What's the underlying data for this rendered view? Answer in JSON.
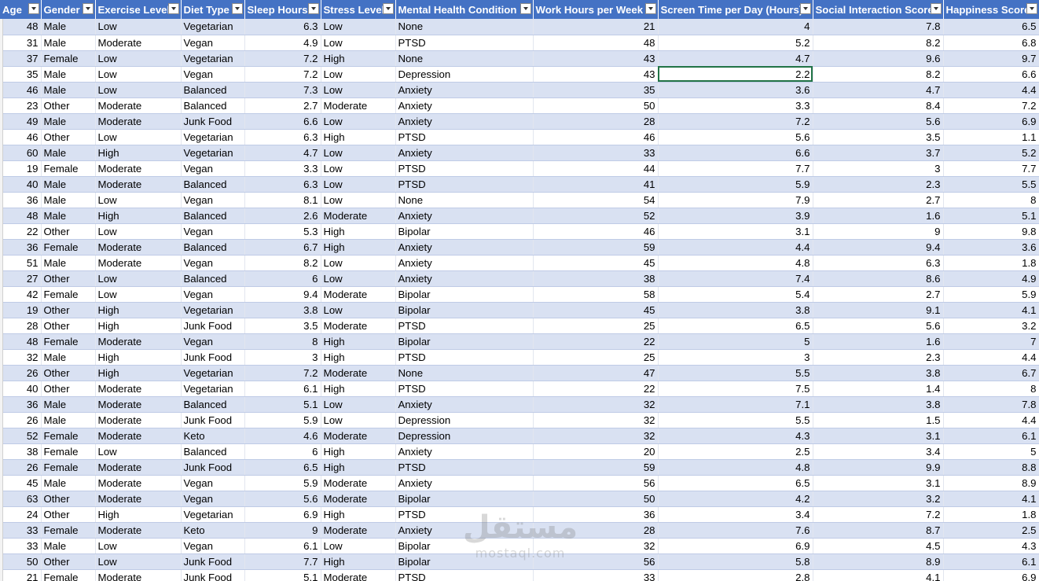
{
  "columns": [
    "Age",
    "Gender",
    "Exercise Level",
    "Diet Type",
    "Sleep Hours",
    "Stress Level",
    "Mental Health Condition",
    "Work Hours per Week",
    "Screen Time per Day (Hours)",
    "Social Interaction Score",
    "Happiness Score"
  ],
  "rows": [
    [
      "48",
      "Male",
      "Low",
      "Vegetarian",
      "6.3",
      "Low",
      "None",
      "21",
      "4",
      "7.8",
      "6.5"
    ],
    [
      "31",
      "Male",
      "Moderate",
      "Vegan",
      "4.9",
      "Low",
      "PTSD",
      "48",
      "5.2",
      "8.2",
      "6.8"
    ],
    [
      "37",
      "Female",
      "Low",
      "Vegetarian",
      "7.2",
      "High",
      "None",
      "43",
      "4.7",
      "9.6",
      "9.7"
    ],
    [
      "35",
      "Male",
      "Low",
      "Vegan",
      "7.2",
      "Low",
      "Depression",
      "43",
      "2.2",
      "8.2",
      "6.6"
    ],
    [
      "46",
      "Male",
      "Low",
      "Balanced",
      "7.3",
      "Low",
      "Anxiety",
      "35",
      "3.6",
      "4.7",
      "4.4"
    ],
    [
      "23",
      "Other",
      "Moderate",
      "Balanced",
      "2.7",
      "Moderate",
      "Anxiety",
      "50",
      "3.3",
      "8.4",
      "7.2"
    ],
    [
      "49",
      "Male",
      "Moderate",
      "Junk Food",
      "6.6",
      "Low",
      "Anxiety",
      "28",
      "7.2",
      "5.6",
      "6.9"
    ],
    [
      "46",
      "Other",
      "Low",
      "Vegetarian",
      "6.3",
      "High",
      "PTSD",
      "46",
      "5.6",
      "3.5",
      "1.1"
    ],
    [
      "60",
      "Male",
      "High",
      "Vegetarian",
      "4.7",
      "Low",
      "Anxiety",
      "33",
      "6.6",
      "3.7",
      "5.2"
    ],
    [
      "19",
      "Female",
      "Moderate",
      "Vegan",
      "3.3",
      "Low",
      "PTSD",
      "44",
      "7.7",
      "3",
      "7.7"
    ],
    [
      "40",
      "Male",
      "Moderate",
      "Balanced",
      "6.3",
      "Low",
      "PTSD",
      "41",
      "5.9",
      "2.3",
      "5.5"
    ],
    [
      "36",
      "Male",
      "Low",
      "Vegan",
      "8.1",
      "Low",
      "None",
      "54",
      "7.9",
      "2.7",
      "8"
    ],
    [
      "48",
      "Male",
      "High",
      "Balanced",
      "2.6",
      "Moderate",
      "Anxiety",
      "52",
      "3.9",
      "1.6",
      "5.1"
    ],
    [
      "22",
      "Other",
      "Low",
      "Vegan",
      "5.3",
      "High",
      "Bipolar",
      "46",
      "3.1",
      "9",
      "9.8"
    ],
    [
      "36",
      "Female",
      "Moderate",
      "Balanced",
      "6.7",
      "High",
      "Anxiety",
      "59",
      "4.4",
      "9.4",
      "3.6"
    ],
    [
      "51",
      "Male",
      "Moderate",
      "Vegan",
      "8.2",
      "Low",
      "Anxiety",
      "45",
      "4.8",
      "6.3",
      "1.8"
    ],
    [
      "27",
      "Other",
      "Low",
      "Balanced",
      "6",
      "Low",
      "Anxiety",
      "38",
      "7.4",
      "8.6",
      "4.9"
    ],
    [
      "42",
      "Female",
      "Low",
      "Vegan",
      "9.4",
      "Moderate",
      "Bipolar",
      "58",
      "5.4",
      "2.7",
      "5.9"
    ],
    [
      "19",
      "Other",
      "High",
      "Vegetarian",
      "3.8",
      "Low",
      "Bipolar",
      "45",
      "3.8",
      "9.1",
      "4.1"
    ],
    [
      "28",
      "Other",
      "High",
      "Junk Food",
      "3.5",
      "Moderate",
      "PTSD",
      "25",
      "6.5",
      "5.6",
      "3.2"
    ],
    [
      "48",
      "Female",
      "Moderate",
      "Vegan",
      "8",
      "High",
      "Bipolar",
      "22",
      "5",
      "1.6",
      "7"
    ],
    [
      "32",
      "Male",
      "High",
      "Junk Food",
      "3",
      "High",
      "PTSD",
      "25",
      "3",
      "2.3",
      "4.4"
    ],
    [
      "26",
      "Other",
      "High",
      "Vegetarian",
      "7.2",
      "Moderate",
      "None",
      "47",
      "5.5",
      "3.8",
      "6.7"
    ],
    [
      "40",
      "Other",
      "Moderate",
      "Vegetarian",
      "6.1",
      "High",
      "PTSD",
      "22",
      "7.5",
      "1.4",
      "8"
    ],
    [
      "36",
      "Male",
      "Moderate",
      "Balanced",
      "5.1",
      "Low",
      "Anxiety",
      "32",
      "7.1",
      "3.8",
      "7.8"
    ],
    [
      "26",
      "Male",
      "Moderate",
      "Junk Food",
      "5.9",
      "Low",
      "Depression",
      "32",
      "5.5",
      "1.5",
      "4.4"
    ],
    [
      "52",
      "Female",
      "Moderate",
      "Keto",
      "4.6",
      "Moderate",
      "Depression",
      "32",
      "4.3",
      "3.1",
      "6.1"
    ],
    [
      "38",
      "Female",
      "Low",
      "Balanced",
      "6",
      "High",
      "Anxiety",
      "20",
      "2.5",
      "3.4",
      "5"
    ],
    [
      "26",
      "Female",
      "Moderate",
      "Junk Food",
      "6.5",
      "High",
      "PTSD",
      "59",
      "4.8",
      "9.9",
      "8.8"
    ],
    [
      "45",
      "Male",
      "Moderate",
      "Vegan",
      "5.9",
      "Moderate",
      "Anxiety",
      "56",
      "6.5",
      "3.1",
      "8.9"
    ],
    [
      "63",
      "Other",
      "Moderate",
      "Vegan",
      "5.6",
      "Moderate",
      "Bipolar",
      "50",
      "4.2",
      "3.2",
      "4.1"
    ],
    [
      "24",
      "Other",
      "High",
      "Vegetarian",
      "6.9",
      "High",
      "PTSD",
      "36",
      "3.4",
      "7.2",
      "1.8"
    ],
    [
      "33",
      "Female",
      "Moderate",
      "Keto",
      "9",
      "Moderate",
      "Anxiety",
      "28",
      "7.6",
      "8.7",
      "2.5"
    ],
    [
      "33",
      "Male",
      "Low",
      "Vegan",
      "6.1",
      "Low",
      "Bipolar",
      "32",
      "6.9",
      "4.5",
      "4.3"
    ],
    [
      "50",
      "Other",
      "Low",
      "Junk Food",
      "7.7",
      "High",
      "Bipolar",
      "56",
      "5.8",
      "8.9",
      "6.1"
    ],
    [
      "21",
      "Female",
      "Moderate",
      "Junk Food",
      "5.1",
      "Moderate",
      "PTSD",
      "33",
      "2.8",
      "4.1",
      "6.9"
    ]
  ],
  "numeric_columns": [
    0,
    4,
    7,
    8,
    9,
    10
  ],
  "selected_cell": {
    "row": 3,
    "col": 8
  },
  "watermark": {
    "logo_text": "مستقل",
    "site": "mostaql.com"
  },
  "colors": {
    "header_bg": "#4472c4",
    "band_bg": "#d9e1f2",
    "selection": "#217346"
  }
}
